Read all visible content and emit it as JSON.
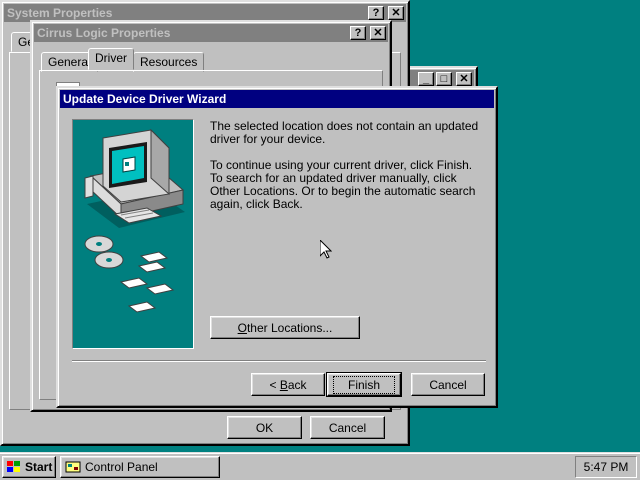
{
  "system_properties": {
    "title": "System Properties",
    "tab_partial": "Ge",
    "ok_label": "OK",
    "cancel_label": "Cancel"
  },
  "cirrus": {
    "title": "Cirrus Logic Properties",
    "tabs": [
      {
        "label": "General"
      },
      {
        "label": "Driver"
      },
      {
        "label": "Resources"
      }
    ]
  },
  "background_window": {
    "title": ""
  },
  "title_buttons": {
    "help": "?",
    "close": "✕",
    "min": "_",
    "max": "□"
  },
  "wizard": {
    "title": "Update Device Driver Wizard",
    "message_1": "The selected location does not contain an updated driver for your device.",
    "message_2": "To continue using your current driver, click Finish. To search for an updated driver manually, click Other Locations. Or to begin the automatic search again, click Back.",
    "other_locations": {
      "accel": "O",
      "rest": "ther Locations..."
    },
    "back": {
      "prefix": "< ",
      "accel": "B",
      "rest": "ack"
    },
    "finish_label": "Finish",
    "cancel_label": "Cancel"
  },
  "taskbar": {
    "start_label": "Start",
    "task_label": "Control Panel",
    "clock": "5:47 PM"
  },
  "colors": {
    "desktop": "#008080",
    "window_face": "#c0c0c0",
    "active_title": "#000080",
    "inactive_title": "#808080",
    "wizard_art_bg": "#007f7f"
  },
  "icons": [
    "help-icon",
    "close-icon",
    "minimize-icon",
    "maximize-icon",
    "windows-logo-icon",
    "control-panel-icon",
    "mouse-cursor-icon",
    "computer-illustration-icon"
  ]
}
